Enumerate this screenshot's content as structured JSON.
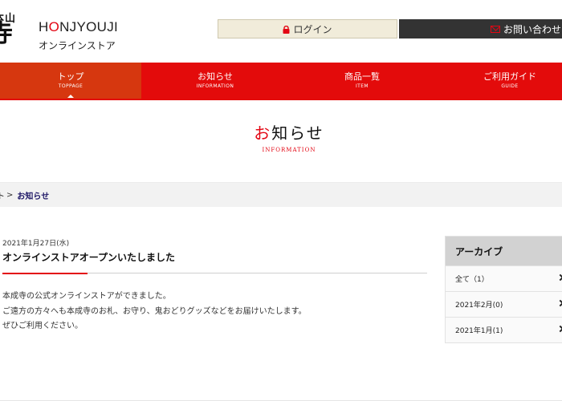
{
  "logo": {
    "kanji_top": "本山",
    "kanji_big": "寺",
    "name_en_prefix": "H",
    "name_en_highlight": "O",
    "name_en_rest": "NJYOUJI",
    "name_jp": "オンラインストア"
  },
  "header": {
    "login_label": "ログイン",
    "contact_label": "お問い合わせ",
    "login_icon": "lock-icon",
    "contact_icon": "mail-icon",
    "login_bg": "#f1ecda",
    "contact_bg": "#333333"
  },
  "nav": {
    "items": [
      {
        "label": "トップ",
        "sub": "TOPPAGE"
      },
      {
        "label": "お知らせ",
        "sub": "INFORMATION"
      },
      {
        "label": "商品一覧",
        "sub": "ITEM"
      },
      {
        "label": "ご利用ガイド",
        "sub": "GUIDE"
      }
    ],
    "active_index": 0,
    "bg_color": "#e30b0b",
    "active_color": "#d6370f"
  },
  "page": {
    "title_first": "お",
    "title_rest": "知らせ",
    "subtitle": "INFORMATION",
    "accent_color": "#e30613"
  },
  "breadcrumb": {
    "home": "ト",
    "separator": ">",
    "current": "お知らせ"
  },
  "article": {
    "date": "2021年1月27日(水)",
    "title": "オンラインストアオープンいたしました",
    "body": [
      "本成寺の公式オンラインストアができました。",
      "ご遠方の方々へも本成寺のお札、お守り、鬼おどりグッズなどをお届けいたします。",
      "ぜひご利用ください。"
    ]
  },
  "archive": {
    "heading": "アーカイブ",
    "items": [
      {
        "label": "全て（1）"
      },
      {
        "label": "2021年2月(0)"
      },
      {
        "label": "2021年1月(1)"
      }
    ]
  }
}
